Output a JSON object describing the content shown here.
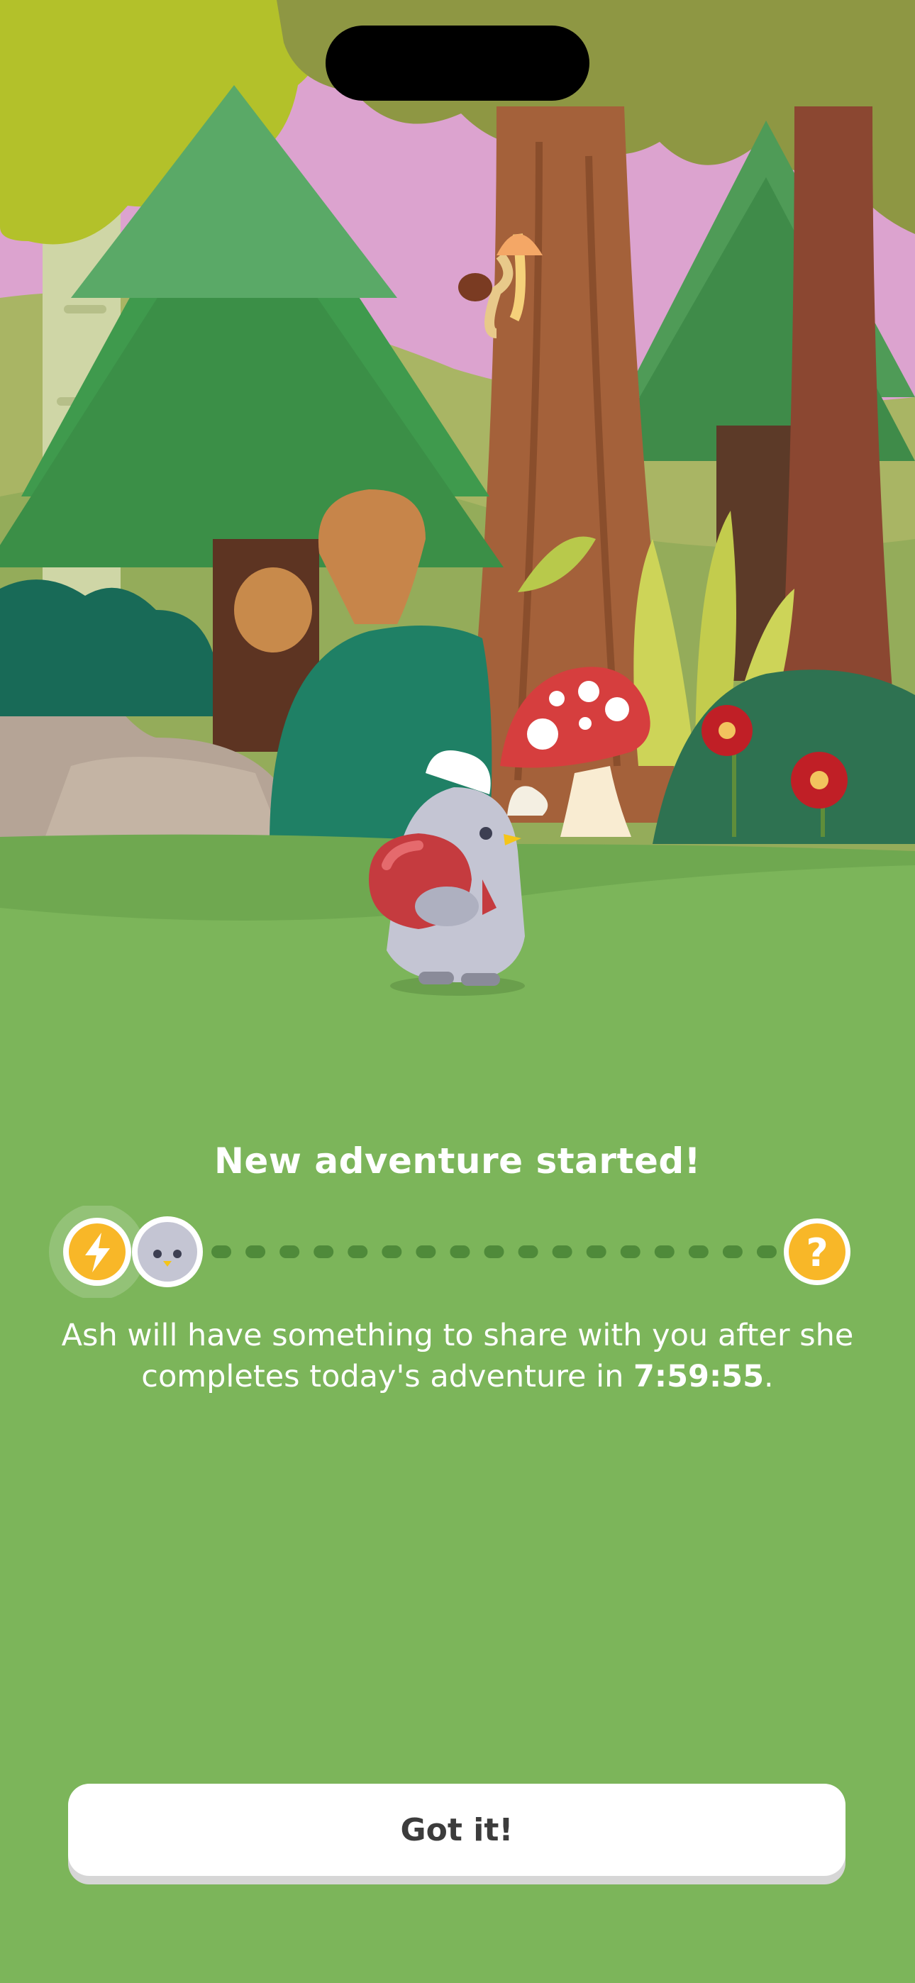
{
  "adventure": {
    "title": "New adventure started!",
    "message_before": "Ash will have something to share with you after she completes today's adventure in ",
    "timer": "7:59:55",
    "message_after": "."
  },
  "progress": {
    "start_icon": "lightning-bolt-icon",
    "avatar_icon": "bird-avatar-icon",
    "end_icon": "question-mark-icon",
    "end_symbol": "?",
    "dash_count": 17
  },
  "actions": {
    "got_it_label": "Got it!"
  },
  "colors": {
    "background_green": "#7cb55a",
    "accent_yellow": "#f8b728",
    "button_white": "#ffffff",
    "button_text": "#3c3c3c",
    "mushroom_red": "#d63e3e"
  }
}
